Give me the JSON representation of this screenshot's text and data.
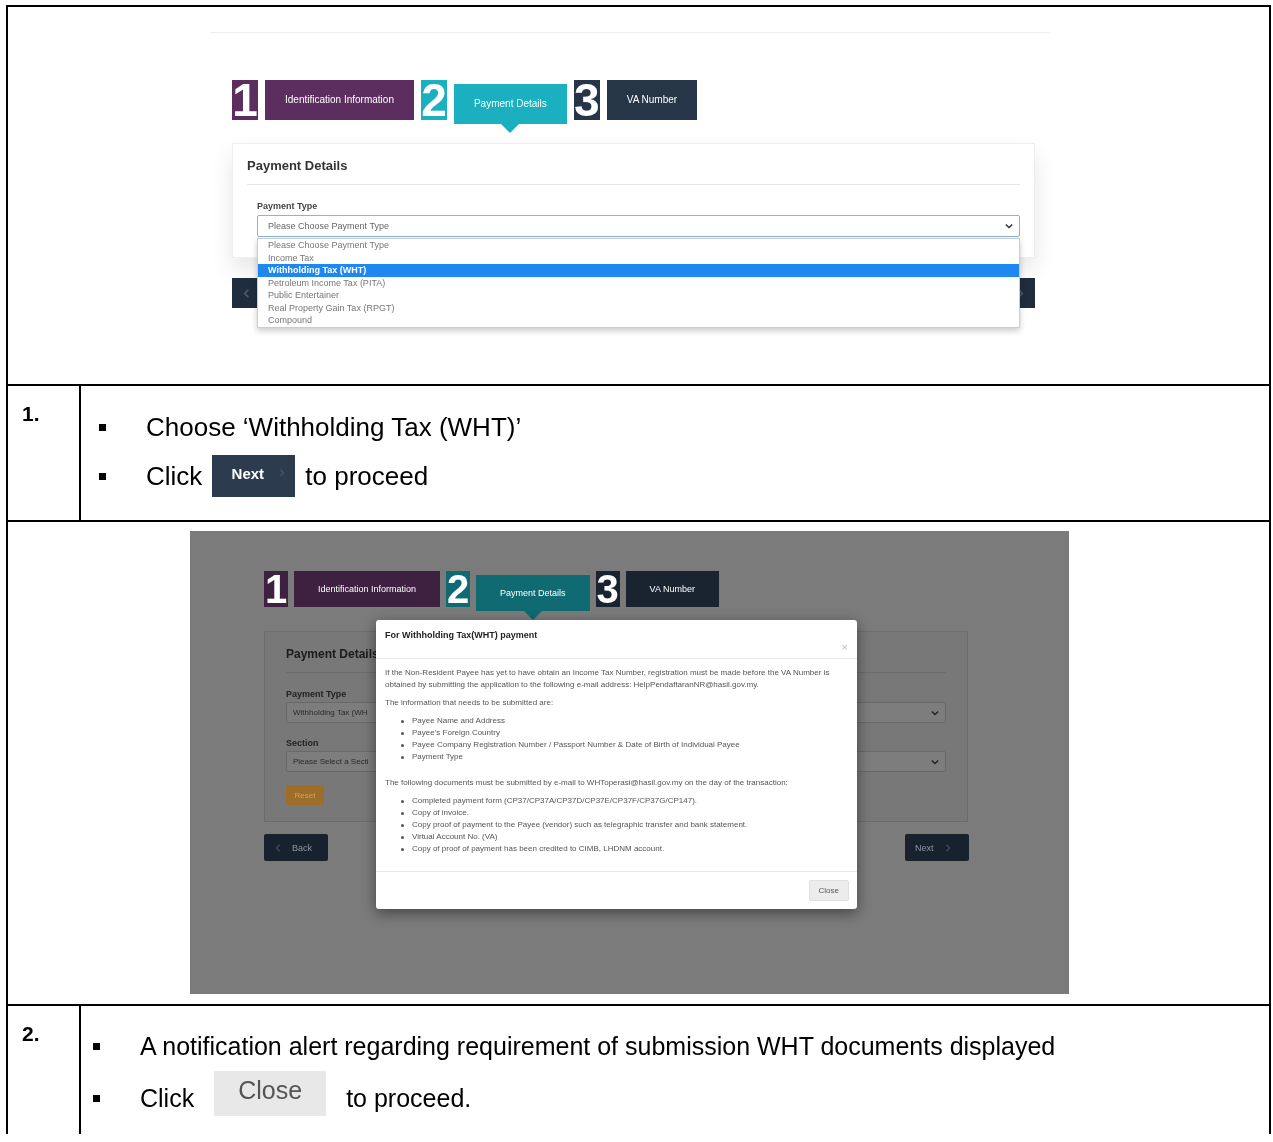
{
  "screenshot_1": {
    "stepper": [
      {
        "number": "1",
        "label": "Identification Information",
        "color": "#5c2d5f",
        "selected": false
      },
      {
        "number": "2",
        "label": "Payment Details",
        "color": "#1ab0c0",
        "selected": true
      },
      {
        "number": "3",
        "label": "VA Number",
        "color": "#263548",
        "selected": false
      }
    ],
    "card_title": "Payment Details",
    "field_label": "Payment Type",
    "select_value": "Please Choose Payment Type",
    "dropdown_options": [
      {
        "label": "Please Choose Payment Type",
        "selected": false
      },
      {
        "label": "Income Tax",
        "selected": false
      },
      {
        "label": "Withholding Tax (WHT)",
        "selected": true
      },
      {
        "label": "Petroleum Income Tax (PITA)",
        "selected": false
      },
      {
        "label": "Public Entertainer",
        "selected": false
      },
      {
        "label": "Real Property Gain Tax (RPGT)",
        "selected": false
      },
      {
        "label": "Compound",
        "selected": false
      }
    ]
  },
  "step_1": {
    "number": "1.",
    "bullets": [
      {
        "kind": "text",
        "text": "Choose ‘Withholding Tax (WHT)’"
      },
      {
        "kind": "next_button",
        "before": "Click",
        "button": "Next",
        "after": "to proceed"
      }
    ]
  },
  "screenshot_2": {
    "stepper": [
      {
        "number": "1",
        "label": "Identification Information",
        "color": "#3e2140",
        "selected": false
      },
      {
        "number": "2",
        "label": "Payment Details",
        "color": "#0f6a72",
        "selected": true
      },
      {
        "number": "3",
        "label": "VA Number",
        "color": "#1a2431",
        "selected": false
      }
    ],
    "card_title": "Payment Details",
    "fields": [
      {
        "label": "Payment Type",
        "value": "Withholding Tax (WH"
      },
      {
        "label": "Section",
        "value": "Please Select a Secti"
      }
    ],
    "reset_button": "Reset",
    "back_button": "Back",
    "next_button": "Next",
    "modal": {
      "title": "For Withholding Tax(WHT) payment",
      "close_icon": "×",
      "blocks": [
        {
          "kind": "paragraph",
          "text": "If the Non-Resident Payee has yet to have obtain an Income Tax Number, registration must be made before the VA Number is obtained by submitting the application to the following e-mail address: HelpPendaftaranNR@hasil.gov.my."
        },
        {
          "kind": "paragraph",
          "text": "The information that needs to be submitted are:"
        },
        {
          "kind": "list",
          "items": [
            "Payee Name and Address",
            "Payee’s Foreign Country",
            "Payee Company Registration Number / Passport Number & Date of Birth of Individual Payee",
            "Payment Type"
          ]
        },
        {
          "kind": "paragraph",
          "text": "The following documents must be submitted by e-mail to WHToperasi@hasil.gov.my on the day of the transaction:"
        },
        {
          "kind": "list",
          "items": [
            "Completed payment form (CP37/CP37A/CP37D/CP37E/CP37F/CP37G/CP147).",
            "Copy of invoice.",
            "Copy proof of payment to the Payee (vendor) such as telegraphic transfer and bank statement.",
            "Virtual Account No. (VA)",
            "Copy of proof of payment has been credited to CIMB, LHDNM account."
          ]
        }
      ],
      "footer_button": "Close"
    }
  },
  "step_2": {
    "number": "2.",
    "bullets": [
      {
        "kind": "text",
        "text": "A notification alert regarding requirement of submission WHT documents displayed"
      },
      {
        "kind": "close_button",
        "before": "Click",
        "button": "Close",
        "after": "to proceed."
      }
    ]
  }
}
